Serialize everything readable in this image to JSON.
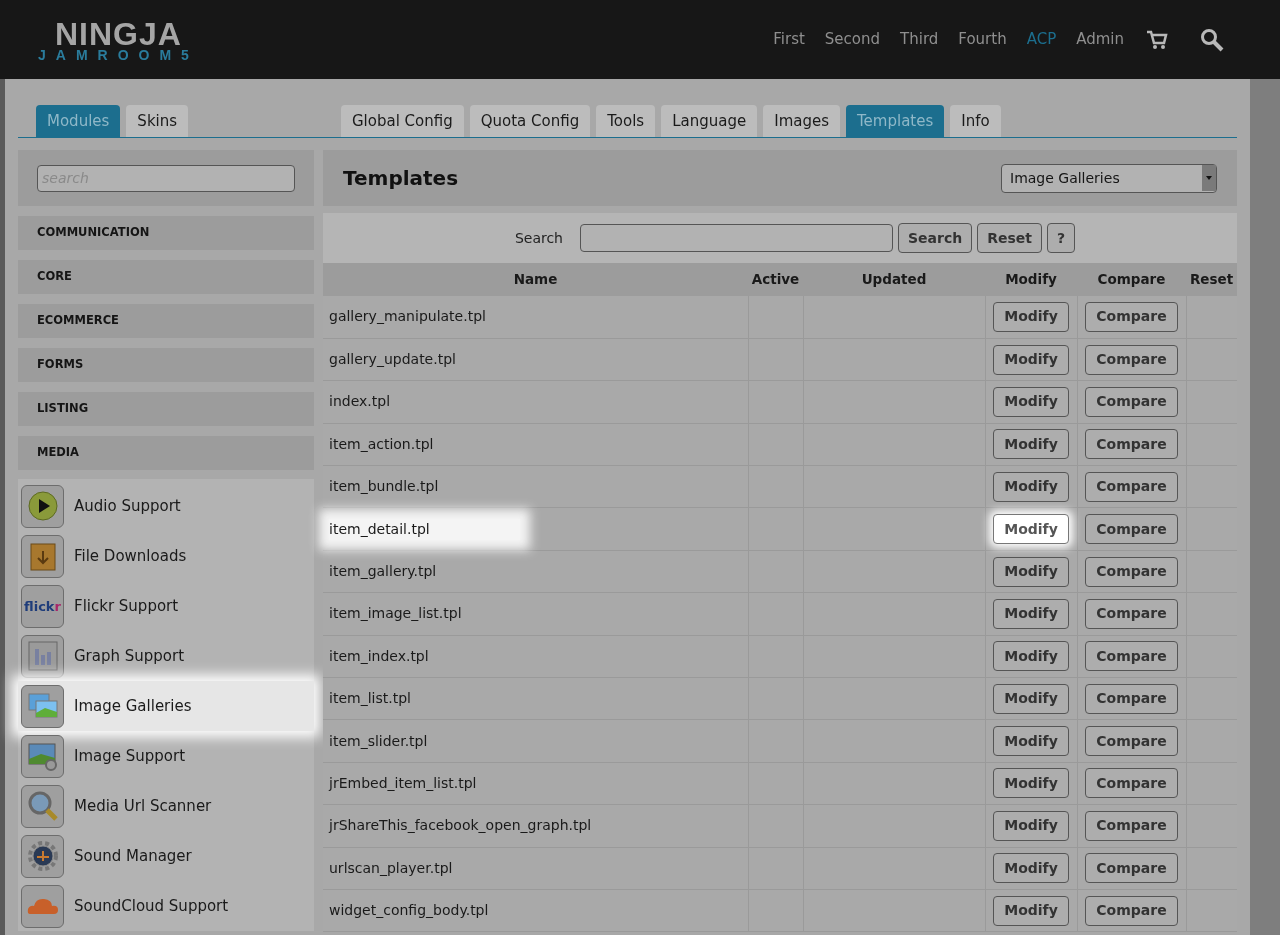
{
  "header": {
    "logo": {
      "top": "NINGJA",
      "bottom": "JAMROOM5"
    },
    "nav": [
      {
        "label": "First",
        "selected": false
      },
      {
        "label": "Second",
        "selected": false
      },
      {
        "label": "Third",
        "selected": false
      },
      {
        "label": "Fourth",
        "selected": false
      },
      {
        "label": "ACP",
        "selected": true
      },
      {
        "label": "Admin",
        "selected": false
      }
    ]
  },
  "left_tabs": [
    {
      "label": "Modules",
      "selected": true
    },
    {
      "label": "Skins",
      "selected": false
    }
  ],
  "right_tabs": [
    {
      "label": "Global Config",
      "selected": false
    },
    {
      "label": "Quota Config",
      "selected": false
    },
    {
      "label": "Tools",
      "selected": false
    },
    {
      "label": "Language",
      "selected": false
    },
    {
      "label": "Images",
      "selected": false
    },
    {
      "label": "Templates",
      "selected": true
    },
    {
      "label": "Info",
      "selected": false
    }
  ],
  "sidebar": {
    "search": {
      "placeholder": "search"
    },
    "categories": [
      "COMMUNICATION",
      "CORE",
      "ECOMMERCE",
      "FORMS",
      "LISTING",
      "MEDIA"
    ],
    "modules": [
      {
        "label": "Audio Support",
        "kind": "play",
        "selected": false
      },
      {
        "label": "File Downloads",
        "kind": "box",
        "selected": false
      },
      {
        "label": "Flickr Support",
        "kind": "flickr",
        "selected": false
      },
      {
        "label": "Graph Support",
        "kind": "graph",
        "selected": false
      },
      {
        "label": "Image Galleries",
        "kind": "gallery",
        "selected": true
      },
      {
        "label": "Image Support",
        "kind": "image",
        "selected": false
      },
      {
        "label": "Media Url Scanner",
        "kind": "magnifier",
        "selected": false
      },
      {
        "label": "Sound Manager",
        "kind": "gear",
        "selected": false
      },
      {
        "label": "SoundCloud Support",
        "kind": "cloud",
        "selected": false
      }
    ],
    "flickr_logo": {
      "a": "flick",
      "b": "r"
    }
  },
  "panel": {
    "title": "Templates",
    "module_select": "Image Galleries",
    "search_label": "Search",
    "buttons": [
      "Search",
      "Reset",
      "?"
    ],
    "columns": [
      "Name",
      "Active",
      "Updated",
      "Modify",
      "Compare",
      "Reset"
    ],
    "rows": [
      {
        "name": "gallery_manipulate.tpl",
        "modify": "Modify",
        "compare": "Compare",
        "highlighted": false
      },
      {
        "name": "gallery_update.tpl",
        "modify": "Modify",
        "compare": "Compare",
        "highlighted": false
      },
      {
        "name": "index.tpl",
        "modify": "Modify",
        "compare": "Compare",
        "highlighted": false
      },
      {
        "name": "item_action.tpl",
        "modify": "Modify",
        "compare": "Compare",
        "highlighted": false
      },
      {
        "name": "item_bundle.tpl",
        "modify": "Modify",
        "compare": "Compare",
        "highlighted": false
      },
      {
        "name": "item_detail.tpl",
        "modify": "Modify",
        "compare": "Compare",
        "highlighted": true
      },
      {
        "name": "item_gallery.tpl",
        "modify": "Modify",
        "compare": "Compare",
        "highlighted": false
      },
      {
        "name": "item_image_list.tpl",
        "modify": "Modify",
        "compare": "Compare",
        "highlighted": false
      },
      {
        "name": "item_index.tpl",
        "modify": "Modify",
        "compare": "Compare",
        "highlighted": false
      },
      {
        "name": "item_list.tpl",
        "modify": "Modify",
        "compare": "Compare",
        "highlighted": false
      },
      {
        "name": "item_slider.tpl",
        "modify": "Modify",
        "compare": "Compare",
        "highlighted": false
      },
      {
        "name": "jrEmbed_item_list.tpl",
        "modify": "Modify",
        "compare": "Compare",
        "highlighted": false
      },
      {
        "name": "jrShareThis_facebook_open_graph.tpl",
        "modify": "Modify",
        "compare": "Compare",
        "highlighted": false
      },
      {
        "name": "urlscan_player.tpl",
        "modify": "Modify",
        "compare": "Compare",
        "highlighted": false
      },
      {
        "name": "widget_config_body.tpl",
        "modify": "Modify",
        "compare": "Compare",
        "highlighted": false
      }
    ]
  }
}
